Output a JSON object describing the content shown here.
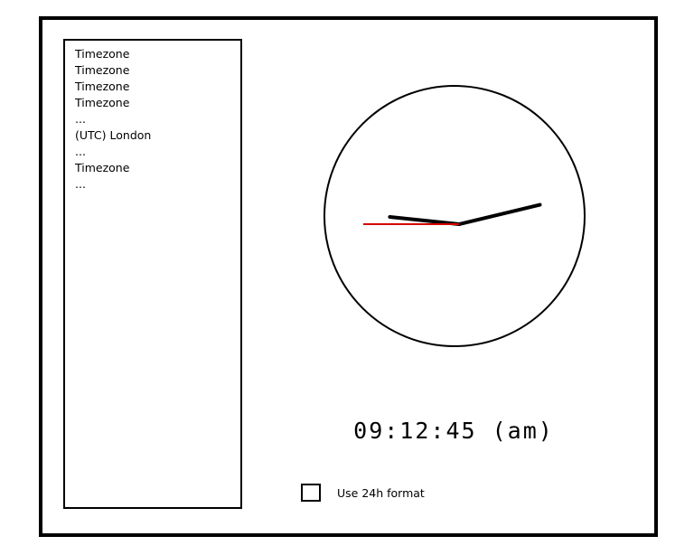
{
  "timezone_list": {
    "items": [
      "Timezone",
      "Timezone",
      "Timezone",
      "Timezone",
      "...",
      "(UTC) London",
      "...",
      "Timezone",
      "..."
    ]
  },
  "clock": {
    "hours": 9,
    "minutes": 12,
    "seconds": 45,
    "hand_color": "#000000",
    "second_hand_color": "#d40000",
    "face_color": "#ffffff"
  },
  "digital_time": {
    "text": "09:12:45 (am)"
  },
  "format_option": {
    "label": "Use 24h format",
    "checked": false
  }
}
